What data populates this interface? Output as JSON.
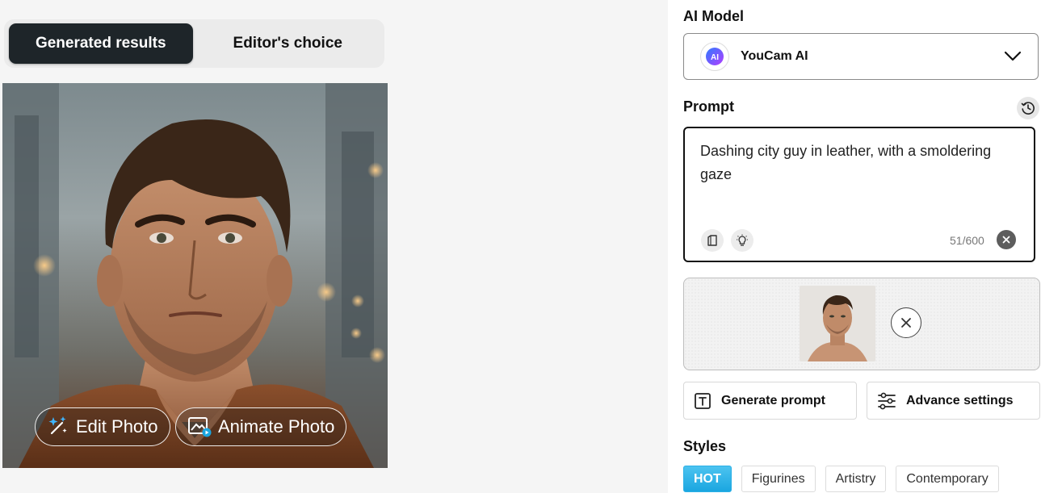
{
  "tabs": [
    {
      "label": "Generated results",
      "active": true
    },
    {
      "label": "Editor's choice",
      "active": false
    }
  ],
  "result": {
    "edit_label": "Edit Photo",
    "animate_label": "Animate Photo"
  },
  "panel": {
    "model_heading": "AI Model",
    "model_name": "YouCam AI",
    "model_logo_text": "AI",
    "prompt_heading": "Prompt",
    "prompt_text": "Dashing city guy in leather, with a smoldering gaze",
    "char_count": "51/600",
    "generate_prompt_label": "Generate prompt",
    "advance_settings_label": "Advance settings",
    "styles_heading": "Styles",
    "style_chips": [
      "HOT",
      "Figurines",
      "Artistry",
      "Contemporary"
    ]
  },
  "colors": {
    "active_tab": "#1e2529",
    "accent_blue": "#1aa6e0",
    "panel_bg": "#ffffff",
    "page_bg": "#f5f5f5"
  },
  "icons": {
    "edit": "sparkle-wand-icon",
    "animate": "animate-photo-icon",
    "dropdown": "chevron-down-icon",
    "history": "history-clock-icon",
    "template": "prompt-template-icon",
    "idea": "lightbulb-icon",
    "clear": "close-icon",
    "generate_prompt": "text-t-icon",
    "settings": "sliders-icon"
  }
}
